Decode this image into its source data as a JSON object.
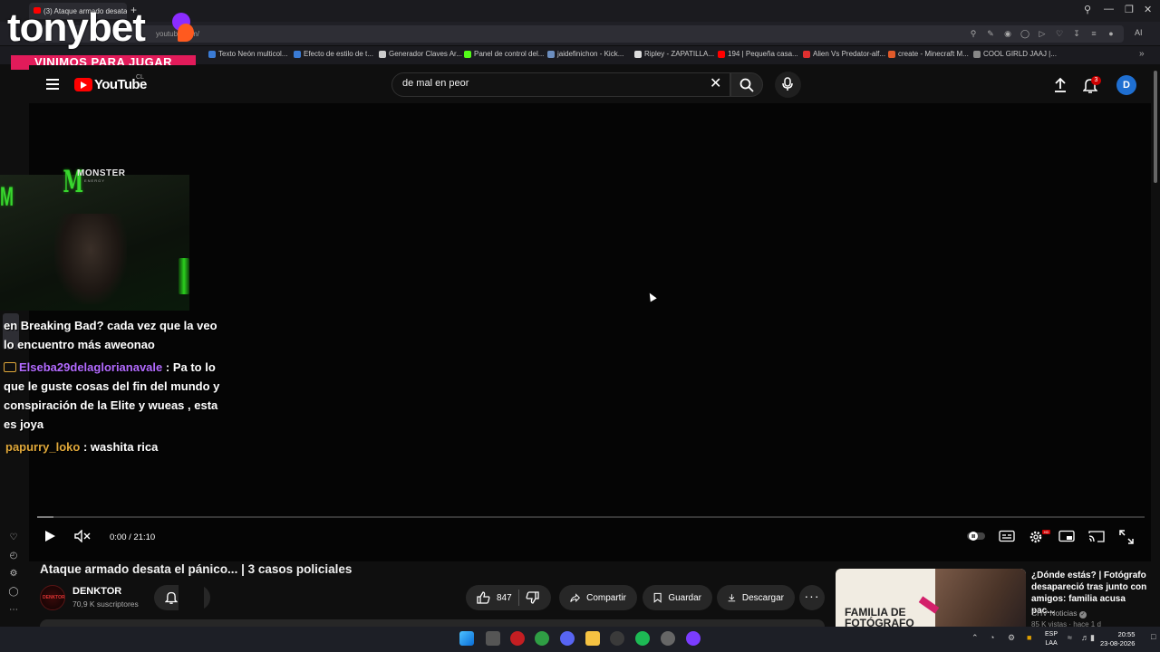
{
  "browser": {
    "tab_title": "(3) Ataque armado desata",
    "url_fragment": "youtube.com/",
    "ai_label": "AI",
    "bookmarks": [
      {
        "label": "Texto Neón multicol...",
        "color": "#3a7bd5"
      },
      {
        "label": "Efecto de estilo de t...",
        "color": "#3a7bd5"
      },
      {
        "label": "Generador Claves Ar...",
        "color": "#cccccc"
      },
      {
        "label": "Panel de control del...",
        "color": "#53fc18"
      },
      {
        "label": "jaidefinichon - Kick...",
        "color": "#6c8ebf"
      },
      {
        "label": "Ripley - ZAPATILLA...",
        "color": "#dddddd"
      },
      {
        "label": "194 | Pequeña casa...",
        "color": "#ff0000"
      },
      {
        "label": "Alien Vs Predator-alf...",
        "color": "#e03030"
      },
      {
        "label": "create - Minecraft M...",
        "color": "#e05a2a"
      },
      {
        "label": "COOL GIRLD JAAJ |...",
        "color": "#888888"
      }
    ]
  },
  "overlay": {
    "brand": "tonybet",
    "tagline": "VINIMOS PARA JUGAR",
    "monster_word": "MONSTER",
    "monster_sub": "ENERGY"
  },
  "chat": {
    "line1a": "en Breaking Bad? cada vez que la veo",
    "line1b": "lo encuentro más aweonao",
    "msg2_user": "Elseba29delaglorianavale",
    "msg2_text_a": " : Pa to lo",
    "msg2_text_b": "que le guste cosas del fin del mundo y",
    "msg2_text_c": "conspiración de la Elite y wueas , esta",
    "msg2_text_d": "es joya",
    "msg3_user": "papurry_loko",
    "msg3_text": " : washita rica"
  },
  "youtube": {
    "logo_text": "YouTube",
    "region": "CL",
    "search_value": "de mal en peor",
    "notification_count": "3",
    "avatar_letter": "D",
    "player": {
      "time": "0:00 / 21:10",
      "progress_fraction": 0.015
    },
    "video_title": "Ataque armado desata el pánico... | 3 casos policiales",
    "channel_name": "DENKTOR",
    "subscribers": "70,9 K suscriptores",
    "likes": "847",
    "share_label": "Compartir",
    "save_label": "Guardar",
    "download_label": "Descargar",
    "recommended": {
      "thumb_text_a": "FAMILIA DE",
      "thumb_text_b": "FOTÓGRAFO",
      "title": "¿Dónde estás? | Fotógrafo desapareció tras junto con amigos: familia acusa pac...",
      "channel": "CHV Noticias",
      "meta": "85 K vistas · hace 1 d"
    }
  },
  "taskbar": {
    "lang_a": "ESP",
    "lang_b": "LAA",
    "time": "20:55",
    "date": "23-08-2026"
  }
}
